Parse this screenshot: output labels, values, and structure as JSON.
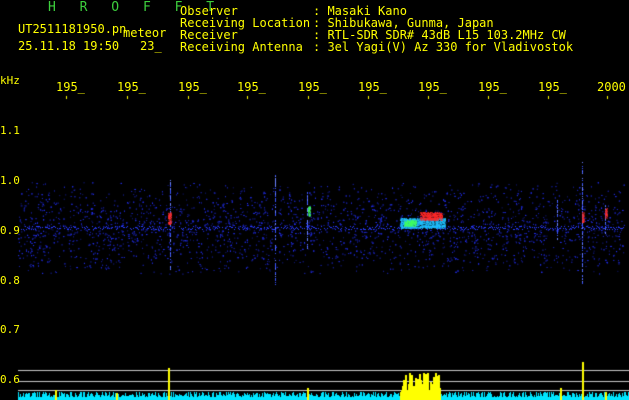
{
  "header": {
    "program": "H R O F F T",
    "filename": "UT2511181950.pn",
    "filename_suffix": "meteor",
    "datetime": "25.11.18 19:50",
    "count": "23_"
  },
  "info": {
    "labels": [
      "Observer",
      "Receiving Location",
      "Receiver",
      "Receiving Antenna"
    ],
    "values": [
      ": Masaki Kano",
      ": Shibukawa, Gunma, Japan",
      ": RTL-SDR SDR# 43dB L15 103.2MHz CW",
      ": 3el Yagi(V) Az 330 for Vladivostok"
    ]
  },
  "axis": {
    "y_unit": "kHz",
    "y_ticks": [
      "1.1",
      "1.0",
      "0.9",
      "0.8",
      "0.7",
      "0.6"
    ],
    "x_ticks": [
      "195_",
      "195_",
      "195_",
      "195_",
      "195_",
      "195_",
      "195_",
      "195_",
      "195_",
      "2000"
    ]
  },
  "colors": {
    "background": "#000000",
    "text": "#ffff00",
    "title": "#3dcf3d",
    "noise": "#1a2acc",
    "meteor": "#ff3030",
    "bar": "#ffff00",
    "baseline": "#00e5ff"
  }
}
